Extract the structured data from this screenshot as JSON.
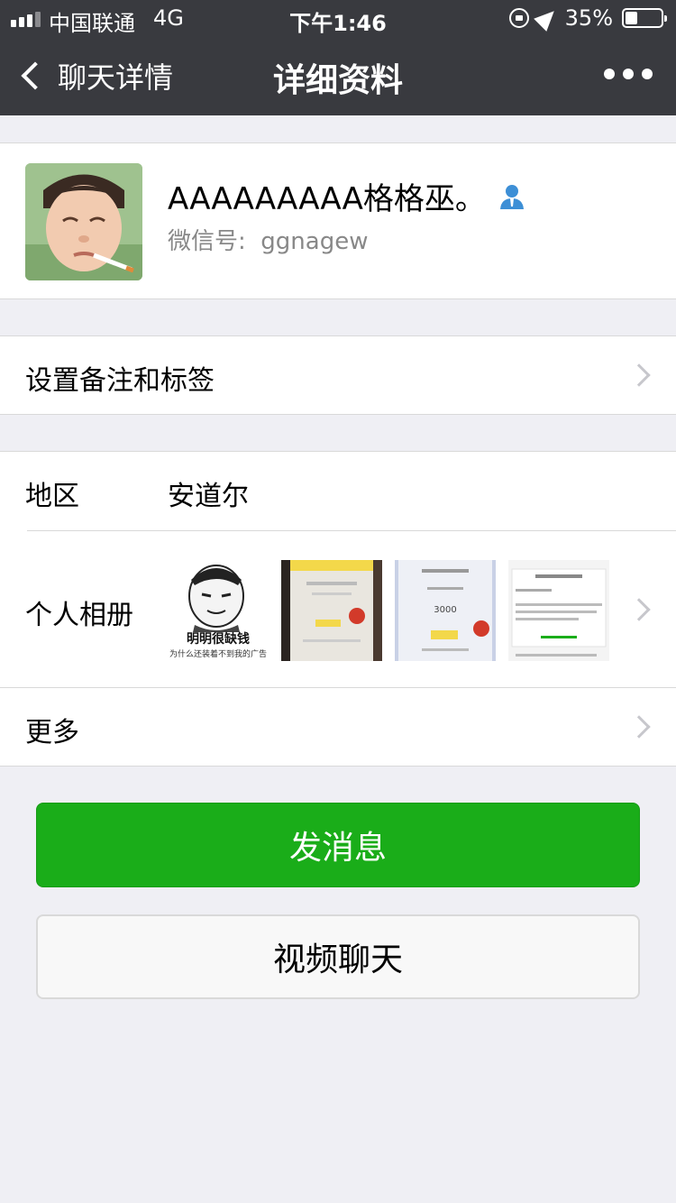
{
  "status_bar": {
    "carrier": "中国联通",
    "network": "4G",
    "time": "下午1:46",
    "battery": "35%",
    "battery_level": 0.35
  },
  "nav": {
    "back_label": "聊天详情",
    "title": "详细资料",
    "more_icon": "more-dots-icon"
  },
  "profile": {
    "name": "AAAAAAAAA格格巫。",
    "wechat_id_label": "微信号:",
    "wechat_id": "ggnagew",
    "badge_icon": "person-icon",
    "badge_color": "#3d8fd6"
  },
  "rows": {
    "remark": {
      "label": "设置备注和标签"
    },
    "region": {
      "label": "地区",
      "value": "安道尔"
    },
    "album": {
      "label": "个人相册",
      "meme_caption": "明明很缺钱",
      "meme_subcaption": "为什么还装着不到我的广告",
      "thumb2_amount": "3000"
    },
    "more": {
      "label": "更多"
    }
  },
  "buttons": {
    "send_message": "发消息",
    "video_call": "视频聊天"
  },
  "colors": {
    "nav_bg": "#393a3f",
    "primary_green": "#1aad19",
    "page_bg": "#efeff4"
  }
}
